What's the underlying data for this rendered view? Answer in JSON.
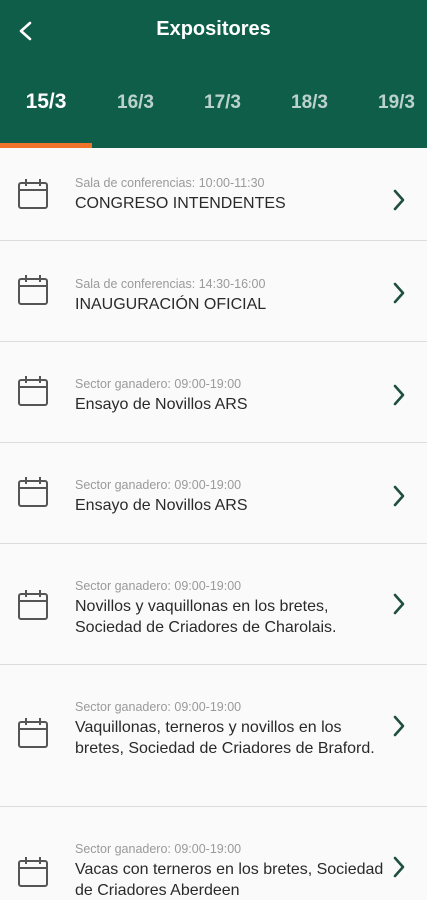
{
  "header": {
    "title": "Expositores",
    "back_icon": "arrow-back-icon",
    "background": "#0e5e49"
  },
  "tabs": [
    {
      "label": "15/3",
      "active": true
    },
    {
      "label": "16/3",
      "active": false
    },
    {
      "label": "17/3",
      "active": false
    },
    {
      "label": "18/3",
      "active": false
    },
    {
      "label": "19/3",
      "active": false
    }
  ],
  "accent": "#f0732b",
  "events": [
    {
      "subtitle": "Sala de conferencias: 10:00-11:30",
      "title": "CONGRESO INTENDENTES"
    },
    {
      "subtitle": "Sala de conferencias: 14:30-16:00",
      "title": "INAUGURACIÓN OFICIAL"
    },
    {
      "subtitle": "Sector ganadero: 09:00-19:00",
      "title": "Ensayo de Novillos ARS"
    },
    {
      "subtitle": "Sector ganadero: 09:00-19:00",
      "title": "Ensayo de Novillos ARS"
    },
    {
      "subtitle": "Sector ganadero: 09:00-19:00",
      "title": "Novillos y vaquillonas en los bretes, Sociedad de Criadores de Charolais."
    },
    {
      "subtitle": "Sector ganadero: 09:00-19:00",
      "title": "Vaquillonas, terneros y novillos en los bretes, Sociedad de Criadores de Braford."
    },
    {
      "subtitle": "Sector ganadero: 09:00-19:00",
      "title": "Vacas con terneros en los bretes, Sociedad de Criadores Aberdeen"
    }
  ],
  "icons": {
    "event": "calendar-icon",
    "open": "chevron-right-icon"
  }
}
